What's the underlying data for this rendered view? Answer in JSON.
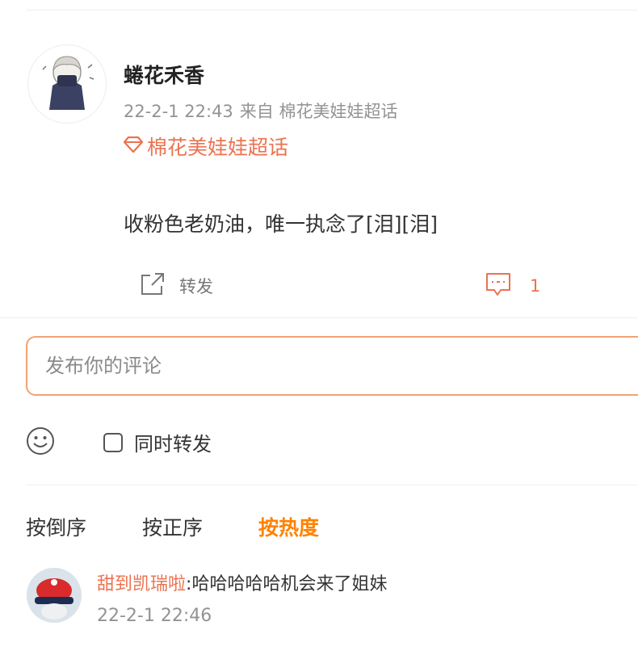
{
  "post": {
    "username": "蜷花禾香",
    "time": "22-2-1 22:43",
    "source": "来自 棉花美娃娃超话",
    "topic": "棉花美娃娃超话",
    "content": "收粉色老奶油，唯一执念了[泪][泪]",
    "repost_label": "转发",
    "comment_count": "1"
  },
  "composer": {
    "placeholder": "发布你的评论",
    "repost_option": "同时转发"
  },
  "sort_tabs": [
    "按倒序",
    "按正序",
    "按热度"
  ],
  "active_sort": "按热度",
  "comments": [
    {
      "author": "甜到凯瑞啦",
      "separator": ":",
      "text": "哈哈哈哈哈机会来了姐妹",
      "time": "22-2-1 22:46"
    }
  ],
  "colors": {
    "accent": "#eb7350",
    "sort_active": "#ff8200",
    "meta": "#939393"
  },
  "icons": [
    "repost-icon",
    "comment-icon",
    "emoji-icon",
    "topic-diamond-icon"
  ]
}
